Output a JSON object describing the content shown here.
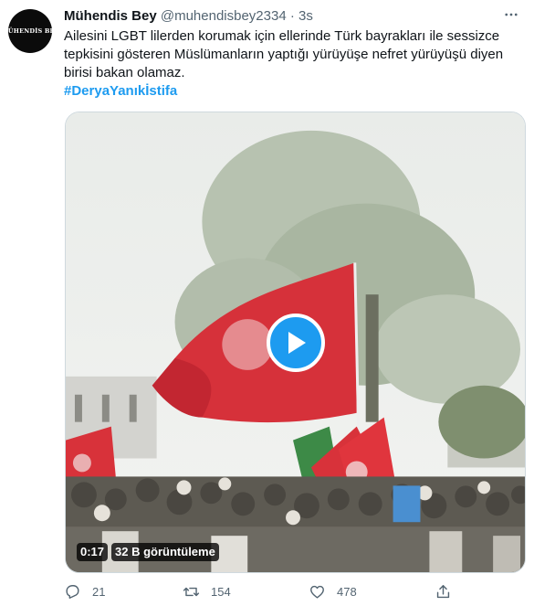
{
  "tweet": {
    "author_name": "Mühendis Bey",
    "handle": "@muhendisbey2334",
    "separator": "·",
    "time": "3s",
    "avatar_text": "MÜHENDİS BEY",
    "text": "Ailesini LGBT lilerden korumak için ellerinde Türk bayrakları ile sessizce tepkisini gösteren Müslümanların yaptığı yürüyüşe nefret yürüyüşü diyen birisi bakan olamaz.",
    "hashtag": "#DeryaYanıkİstifa"
  },
  "video": {
    "duration": "0:17",
    "views": "32 B görüntüleme"
  },
  "actions": {
    "replies": "21",
    "retweets": "154",
    "likes": "478"
  },
  "colors": {
    "accent": "#1d9bf0",
    "secondary_text": "#536471",
    "flag_red": "#e30a17"
  },
  "icons": [
    "more-icon",
    "play-icon",
    "reply-icon",
    "retweet-icon",
    "like-icon",
    "share-icon"
  ]
}
